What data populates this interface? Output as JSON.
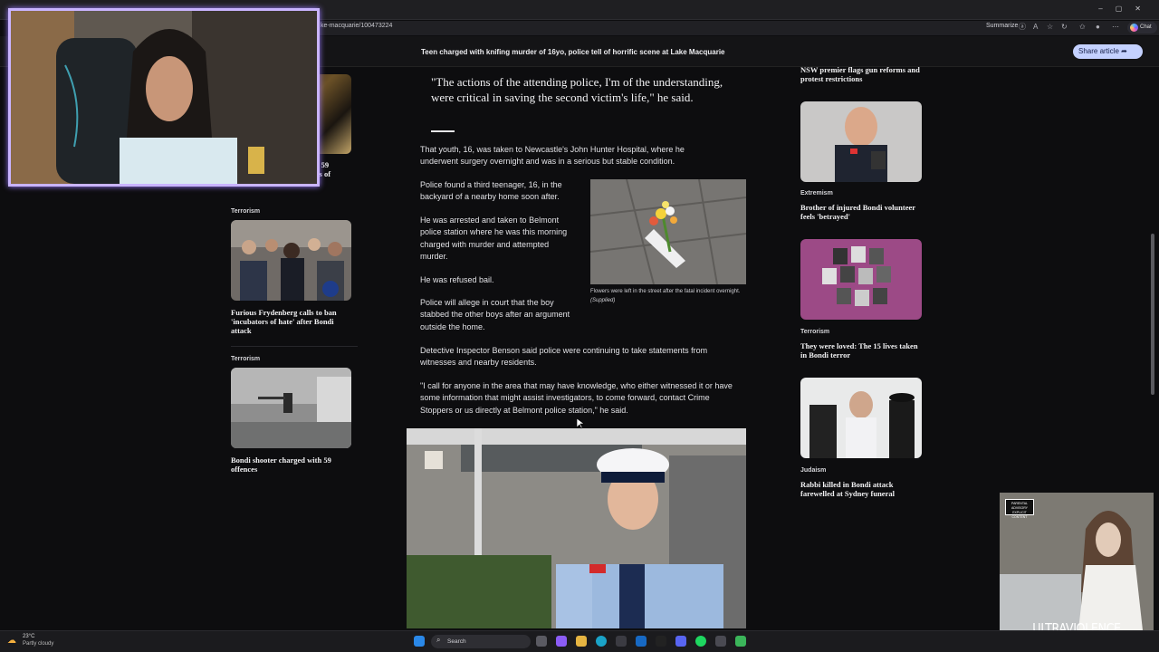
{
  "browser": {
    "url": "ke-macquarie/100473224",
    "summarize_label": "Summarize",
    "chat_label": "Chat",
    "window_controls": "–▢✕"
  },
  "article_bar": {
    "title": "Teen charged with knifing murder of 16yo, police tell of horrific scene at Lake Macquarie",
    "share_label": "Share article ➦"
  },
  "left_rail": {
    "cut_off_title_line1": "th 59",
    "cut_off_title_line2": "nts of",
    "cards": [
      {
        "tag": "Terrorism",
        "title": "Furious Frydenberg calls to ban 'incubators of hate' after Bondi attack"
      },
      {
        "tag": "Terrorism",
        "title": "Bondi shooter charged with 59 offences"
      }
    ]
  },
  "article": {
    "pull_quote": "\"The actions of the attending police, I'm of the understanding, were critical in saving the second victim's life,\" he said.",
    "paragraphs": [
      "That youth, 16, was taken to Newcastle's John Hunter Hospital, where he underwent surgery overnight and was in a serious but stable condition.",
      "Police found a third teenager, 16, in the backyard of a nearby home soon after.",
      "He was arrested and taken to Belmont police station where he was this morning charged with murder and attempted murder.",
      "He was refused bail.",
      "Police will allege in court that the boy stabbed the other boys after an argument outside the home.",
      "Detective Inspector Benson said police were continuing to take statements from witnesses and nearby residents.",
      "\"I call for anyone in the area that may have knowledge, who either witnessed it or have some information that might assist investigators, to come forward, contact Crime Stoppers or us directly at Belmont police station,\" he said."
    ],
    "image_caption": "Flowers were left in the street after the fatal incident overnight.",
    "image_credit": "(Supplied)"
  },
  "right_rail": {
    "top_title": "NSW premier flags gun reforms and protest restrictions",
    "cards": [
      {
        "tag": "Extremism",
        "title": "Brother of injured Bondi volunteer feels 'betrayed'"
      },
      {
        "tag": "Terrorism",
        "title": "They were loved: The 15 lives taken in Bondi terror"
      },
      {
        "tag": "Judaism",
        "title": "Rabbi killed in Bondi attack farewelled at Sydney funeral"
      }
    ]
  },
  "album": {
    "title": "ULTRAVIOLENCE",
    "advisory": "PARENTAL ADVISORY EXPLICIT CONTENT"
  },
  "taskbar": {
    "temperature": "23°C",
    "weather": "Partly cloudy",
    "search_placeholder": "Search"
  },
  "colors": {
    "share_button": "#c4d1ff",
    "webcam_border": "#c9b4ff",
    "background": "#0d0d0f"
  }
}
